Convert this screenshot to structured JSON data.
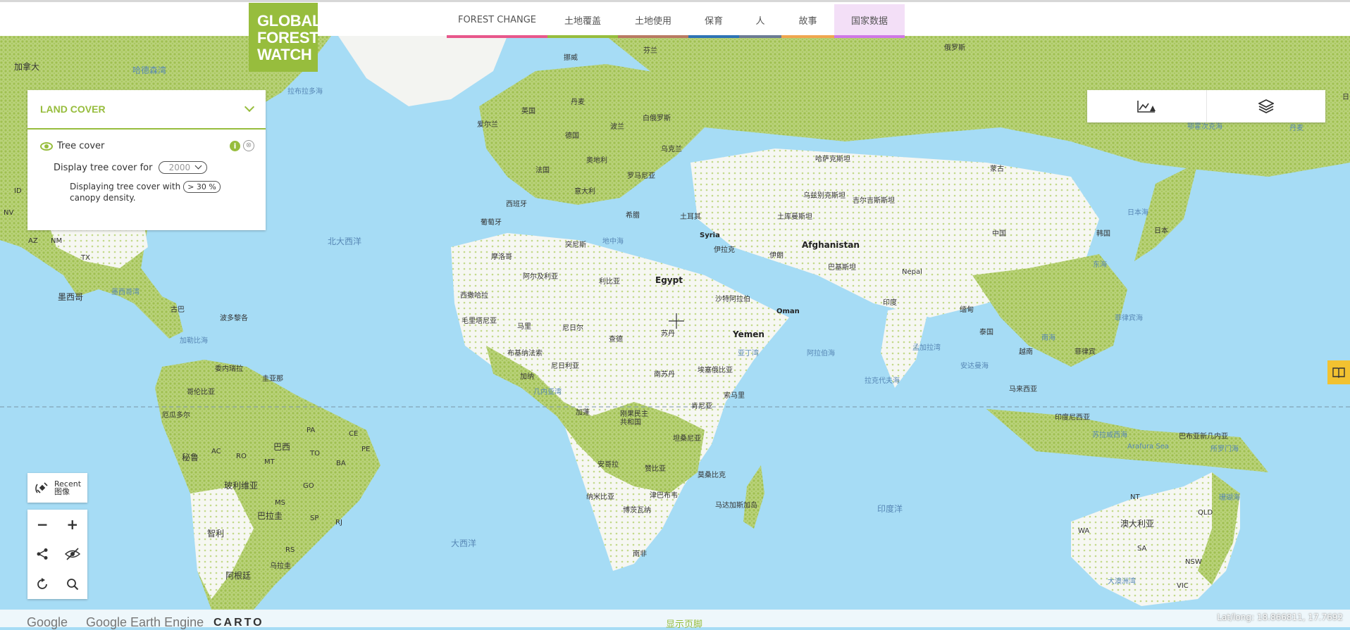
{
  "header": {
    "logo_lines": [
      "GLOBAL",
      "FOREST",
      "WATCH"
    ],
    "nav": [
      {
        "label": "FOREST CHANGE",
        "color": "#e8578b",
        "width": 143,
        "active": false
      },
      {
        "label": "土地覆盖",
        "color": "#97bd3d",
        "width": 100,
        "active": false
      },
      {
        "label": "土地使用",
        "color": "#b97a62",
        "width": 100,
        "active": false
      },
      {
        "label": "保育",
        "color": "#2e73b5",
        "width": 72,
        "active": false
      },
      {
        "label": "人",
        "color": "#6b7b94",
        "width": 60,
        "active": false
      },
      {
        "label": "故事",
        "color": "#f0a64f",
        "width": 75,
        "active": false
      },
      {
        "label": "国家数据",
        "color": "#cf78e6",
        "width": 100,
        "active": true
      }
    ]
  },
  "panel": {
    "title": "LAND COVER",
    "layer_name": "Tree cover",
    "info_icon": "i",
    "close_icon": "⊗",
    "display_label": "Display tree cover for",
    "year": "2000",
    "canopy_text_1": "Displaying tree cover with",
    "canopy_value": "> 30 %",
    "canopy_text_2": "canopy density."
  },
  "tools": {
    "analysis_icon": "analysis-chart-icon",
    "layers_icon": "layers-icon"
  },
  "recent": {
    "line1": "Recent",
    "line2": "图像"
  },
  "controls": {
    "zoom_out": "−",
    "zoom_in": "+"
  },
  "footer": {
    "google": "Google",
    "earth_engine": "Google Earth Engine",
    "carto": "CARTO",
    "toggle": "显示页脚",
    "latlng": "Lat/long: 18.866811, 17.7692"
  },
  "map_labels": {
    "jianada": "加拿大",
    "hudson": "哈德森湾",
    "labrador": "拉布拉多海",
    "north_atlantic": "北大西洋",
    "mexico": "墨西哥",
    "gulf_mexico": "墨西哥湾",
    "cuba": "古巴",
    "bahamas": "波多黎各",
    "caribbean": "加勒比海",
    "venezuela": "委内瑞拉",
    "colombia": "哥伦比亚",
    "guyana": "圭亚那",
    "ecuador": "厄瓜多尔",
    "peru": "秘鲁",
    "brazil": "巴西",
    "bolivia": "玻利维亚",
    "paraguay": "巴拉圭",
    "chile": "智利",
    "argentina": "阿根廷",
    "uruguay": "乌拉圭",
    "south_atlantic": "大西洋",
    "norway": "挪威",
    "finland": "芬兰",
    "uk": "英国",
    "ireland": "爱尔兰",
    "denmark": "丹麦",
    "germany": "德国",
    "poland": "波兰",
    "belarus": "白俄罗斯",
    "ukraine": "乌克兰",
    "france": "法国",
    "austria": "奥地利",
    "romania": "罗马尼亚",
    "italy": "意大利",
    "spain": "西班牙",
    "portugal": "葡萄牙",
    "greece": "希腊",
    "turkey": "土耳其",
    "syria": "Syria",
    "iraq": "伊拉克",
    "iran": "伊朗",
    "saudi": "沙特阿拉伯",
    "yemen": "Yemen",
    "oman": "Oman",
    "afghanistan": "Afghanistan",
    "pakistan": "巴基斯坦",
    "turkmenistan": "土库曼斯坦",
    "uzbekistan": "乌兹别克斯坦",
    "kyrgyz": "吉尔吉斯斯坦",
    "kazakhstan": "哈萨克斯坦",
    "russia": "俄罗斯",
    "mongolia": "蒙古",
    "china": "中国",
    "korea": "韩国",
    "japan": "日本",
    "sea_japan": "日本海",
    "east_sea": "东海",
    "nepal": "Nepal",
    "india": "印度",
    "myanmar": "缅甸",
    "thailand": "泰国",
    "vietnam": "越南",
    "philippines": "菲律宾",
    "philippine_sea": "菲律宾海",
    "south_sea": "南海",
    "malaysia": "马来西亚",
    "indonesia": "印度尼西亚",
    "png": "巴布亚新几内亚",
    "celebes": "苏拉威西海",
    "arafura": "Arafura Sea",
    "solomon": "所罗门海",
    "coral": "珊瑚海",
    "australia": "澳大利亚",
    "nt": "NT",
    "qld": "QLD",
    "wa": "WA",
    "sa": "SA",
    "nsw": "NSW",
    "vic": "VIC",
    "great_australian": "大澳洲湾",
    "okhotsk": "鄂霍次克海",
    "bay_bengal": "孟加拉湾",
    "arabian_sea": "阿拉伯海",
    "andaman": "安达曼海",
    "red_sea": "亚丁湾",
    "mediterranean": "地中海",
    "indian_ocean": "印度洋",
    "lakshadweep": "拉克代夫海",
    "morocco": "摩洛哥",
    "algeria": "阿尔及利亚",
    "tunisia": "突尼斯",
    "libya": "利比亚",
    "egypt": "Egypt",
    "w_sahara": "西撒哈拉",
    "mauritania": "毛里塔尼亚",
    "mali": "马里",
    "niger": "尼日尔",
    "chad": "查德",
    "sudan": "苏丹",
    "s_sudan": "南苏丹",
    "ethiopia": "埃塞俄比亚",
    "somalia": "索马里",
    "kenya": "肯尼亚",
    "nigeria": "尼日利亚",
    "burkina": "布基纳法索",
    "ghana": "加纳",
    "guinea_gulf": "几内亚湾",
    "drc": "刚果民主共和国",
    "gabon": "加蓬",
    "tanzania": "坦桑尼亚",
    "angola": "安哥拉",
    "zambia": "赞比亚",
    "mozambique": "莫桑比克",
    "namibia": "纳米比亚",
    "zimbabwe": "津巴布韦",
    "botswana": "博茨瓦纳",
    "south_africa": "南非",
    "madagascar": "马达加斯加岛",
    "greenland_sea": "丹麦",
    "ocean_east": "日",
    "az": "AZ",
    "nm": "NM",
    "tx": "TX",
    "id": "ID",
    "nv": "NV",
    "to": "TO",
    "mt": "MT",
    "ba": "BA",
    "go": "GO",
    "ms": "MS",
    "sp": "SP",
    "rs": "RS",
    "pa": "PA",
    "ce": "CE",
    "pe": "PE",
    "ro": "RO",
    "ac": "AC",
    "rj": "RJ"
  }
}
